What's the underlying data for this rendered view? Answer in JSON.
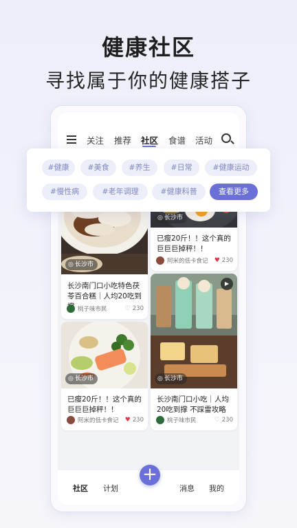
{
  "promo": {
    "title": "健康社区",
    "subtitle": "寻找属于你的健康搭子"
  },
  "topnav": {
    "tabs": [
      {
        "label": "关注",
        "active": false
      },
      {
        "label": "推荐",
        "active": false
      },
      {
        "label": "社区",
        "active": true
      },
      {
        "label": "食谱",
        "active": false
      },
      {
        "label": "活动",
        "active": false
      }
    ],
    "menu_icon": "hamburger-menu-icon",
    "search_icon": "search-icon"
  },
  "tags": {
    "row1": [
      "#健康",
      "#美食",
      "#养生",
      "#日常",
      "#健康运动"
    ],
    "row2": [
      "#慢性病",
      "#老年调理",
      "#健康科普"
    ],
    "more_label": "查看更多"
  },
  "cards": [
    {
      "location": "长沙市",
      "title": "长沙南门口小吃特色茯苓百合糕｜人均20吃到撑",
      "author": "桃子味市民",
      "likes": "230",
      "liked": false,
      "video": false
    },
    {
      "location": "长沙市",
      "title": "已瘦20斤！！这个真的巨巨巨掉秤！！",
      "author": "阿米的低卡食记",
      "likes": "230",
      "liked": true,
      "video": false
    },
    {
      "location": "长沙市",
      "title": "已瘦20斤！！这个真的巨巨巨掉秤！！",
      "author": "阿米的低卡食记",
      "likes": "230",
      "liked": true,
      "video": false
    },
    {
      "location": "长沙市",
      "title": "长沙南门口小吃｜人均20吃到撑 不踩雷攻略",
      "author": "桃子味市民",
      "likes": "230",
      "liked": false,
      "video": true
    }
  ],
  "bottomnav": {
    "items": [
      "社区",
      "计划",
      "消息",
      "我的"
    ],
    "add_label": "+"
  },
  "colors": {
    "accent": "#6a70d8",
    "tag_bg": "#eceef9",
    "tag_text": "#8089c4",
    "liked_heart": "#e2394b"
  }
}
